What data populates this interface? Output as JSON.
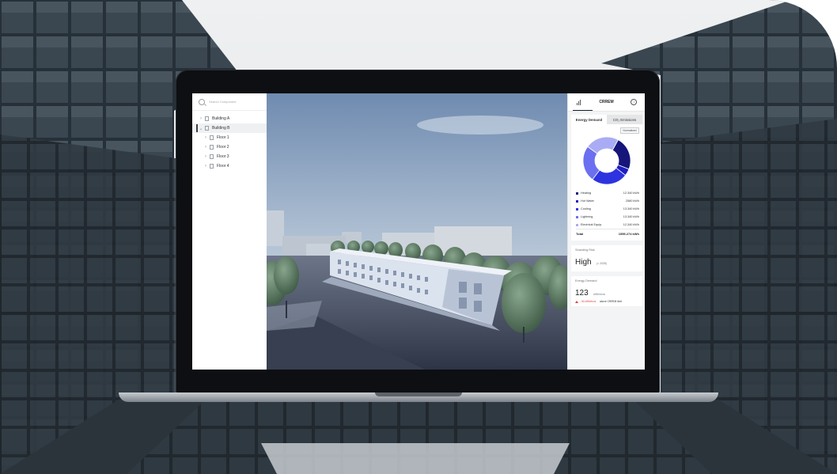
{
  "search": {
    "placeholder": "Search Component"
  },
  "tree": [
    {
      "label": "Building A",
      "icon": "building-icon"
    },
    {
      "label": "Building B",
      "icon": "building-icon",
      "selected": true
    },
    {
      "label": "Floor 1",
      "icon": "floor-icon"
    },
    {
      "label": "Floor 2",
      "icon": "floor-icon"
    },
    {
      "label": "Floor 3",
      "icon": "floor-icon"
    },
    {
      "label": "Floor 4",
      "icon": "floor-icon"
    }
  ],
  "panel": {
    "header_title": "CRREM",
    "tabs": [
      {
        "label": "Energy Demand"
      },
      {
        "label": "CO₂ Emissions"
      }
    ],
    "normalized_label": "Normalized",
    "legend": [
      {
        "label": "Heating",
        "value": "12.340 kWh",
        "color": "#15157a"
      },
      {
        "label": "Hot Water",
        "value": "2580 kWh",
        "color": "#1d1fc0"
      },
      {
        "label": "Cooling",
        "value": "13.340 kWh",
        "color": "#2e33e0"
      },
      {
        "label": "Lightning",
        "value": "13.340 kWh",
        "color": "#6b6ff0"
      },
      {
        "label": "Electrical Equip.",
        "value": "12.340 kWh",
        "color": "#a9acf4"
      }
    ],
    "total_label": "Total",
    "total_value": "1555.274 kWh",
    "stranding": {
      "caption": "Stranding Risk",
      "value": "High",
      "note": "(> 2028)"
    },
    "energy": {
      "caption": "Energy Demand",
      "value": "123",
      "unit": "kWh/m²/a",
      "delta": "- 54 kWh/m²/a",
      "delta_note": "above CRREM limit"
    }
  },
  "chart_data": {
    "type": "pie",
    "categories": [
      "Heating",
      "Hot Water",
      "Cooling",
      "Lightning",
      "Electrical Equip."
    ],
    "values": [
      12.34,
      2.58,
      13.34,
      13.34,
      12.34
    ],
    "units": "kWh"
  }
}
